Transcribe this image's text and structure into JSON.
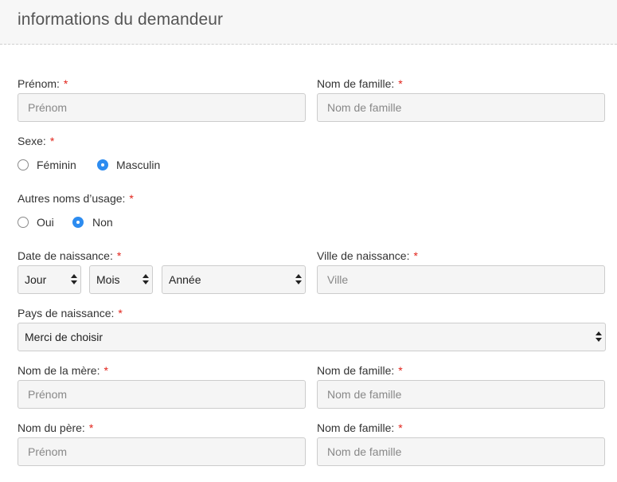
{
  "panel": {
    "title": "informations du demandeur"
  },
  "form": {
    "required_mark": "*",
    "prenom": {
      "label": "Prénom:",
      "placeholder": "Prénom"
    },
    "nom_famille": {
      "label": "Nom de famille:",
      "placeholder": "Nom de famille"
    },
    "sexe": {
      "label": "Sexe:",
      "options": [
        {
          "label": "Féminin",
          "selected": false
        },
        {
          "label": "Masculin",
          "selected": true
        }
      ]
    },
    "autres_noms": {
      "label": "Autres noms d’usage:",
      "options": [
        {
          "label": "Oui",
          "selected": false
        },
        {
          "label": "Non",
          "selected": true
        }
      ]
    },
    "date_naissance": {
      "label": "Date de naissance:",
      "jour": "Jour",
      "mois": "Mois",
      "annee": "Année"
    },
    "ville_naissance": {
      "label": "Ville de naissance:",
      "placeholder": "Ville"
    },
    "pays_naissance": {
      "label": "Pays de naissance:",
      "value": "Merci de choisir"
    },
    "mere": {
      "label": "Nom de la mère:",
      "placeholder": "Prénom"
    },
    "mere_famille": {
      "label": "Nom de famille:",
      "placeholder": "Nom de famille"
    },
    "pere": {
      "label": "Nom du père:",
      "placeholder": "Prénom"
    },
    "pere_famille": {
      "label": "Nom de famille:",
      "placeholder": "Nom de famille"
    }
  },
  "colors": {
    "accent": "#2d8cf0",
    "required": "#e2231a",
    "field_bg": "#f5f5f5",
    "header_bg": "#f7f7f7"
  }
}
